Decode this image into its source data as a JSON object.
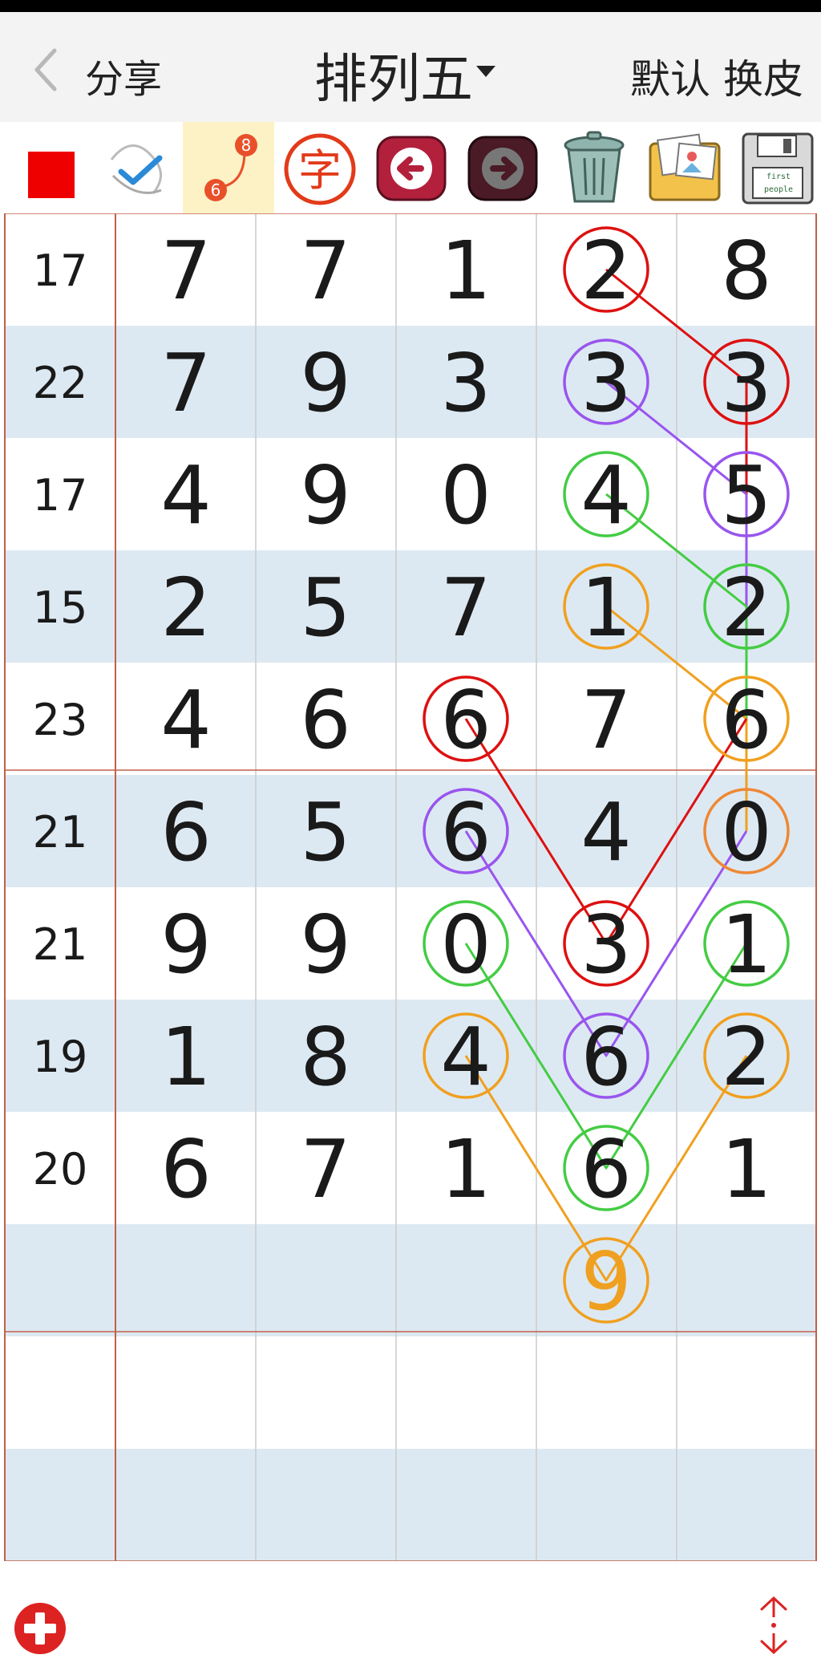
{
  "header": {
    "back_label": "",
    "share_label": "分享",
    "title": "排列五",
    "default_label": "默认",
    "skin_label": "换皮"
  },
  "toolbar": {
    "items": [
      {
        "icon": "red-square-icon",
        "color": "#ee0000"
      },
      {
        "icon": "check-pen-icon"
      },
      {
        "icon": "line-connect-icon",
        "active": true,
        "badge_top": "8",
        "badge_bottom": "6"
      },
      {
        "icon": "char-stamp-icon",
        "text": "字"
      },
      {
        "icon": "undo-arrow-icon"
      },
      {
        "icon": "redo-arrow-icon"
      },
      {
        "icon": "trash-can-icon"
      },
      {
        "icon": "photo-album-icon"
      },
      {
        "icon": "floppy-save-icon",
        "text1": "first",
        "text2": "people"
      }
    ]
  },
  "table": {
    "rows": [
      {
        "sum": "17",
        "digits": [
          "7",
          "7",
          "1",
          "2",
          "8"
        ]
      },
      {
        "sum": "22",
        "digits": [
          "7",
          "9",
          "3",
          "3",
          "3"
        ]
      },
      {
        "sum": "17",
        "digits": [
          "4",
          "9",
          "0",
          "4",
          "5"
        ]
      },
      {
        "sum": "15",
        "digits": [
          "2",
          "5",
          "7",
          "1",
          "2"
        ]
      },
      {
        "sum": "23",
        "digits": [
          "4",
          "6",
          "6",
          "7",
          "6"
        ]
      },
      {
        "sum": "21",
        "digits": [
          "6",
          "5",
          "6",
          "4",
          "0"
        ]
      },
      {
        "sum": "21",
        "digits": [
          "9",
          "9",
          "0",
          "3",
          "1"
        ]
      },
      {
        "sum": "19",
        "digits": [
          "1",
          "8",
          "4",
          "6",
          "2"
        ]
      },
      {
        "sum": "20",
        "digits": [
          "6",
          "7",
          "1",
          "6",
          "1"
        ]
      },
      {
        "sum": "",
        "digits": [
          "",
          "",
          "",
          "",
          ""
        ]
      },
      {
        "sum": "",
        "digits": [
          "",
          "",
          "",
          "",
          ""
        ]
      },
      {
        "sum": "",
        "digits": [
          "",
          "",
          "",
          "",
          ""
        ]
      }
    ],
    "predicted": {
      "row": 9,
      "col": 3,
      "value": "9",
      "color": "#f0a020"
    },
    "circles": [
      {
        "row": 0,
        "col": 3,
        "color": "#dd1111"
      },
      {
        "row": 1,
        "col": 4,
        "color": "#dd1111"
      },
      {
        "row": 1,
        "col": 3,
        "color": "#9955ee"
      },
      {
        "row": 2,
        "col": 4,
        "color": "#9955ee"
      },
      {
        "row": 2,
        "col": 3,
        "color": "#44cc44"
      },
      {
        "row": 3,
        "col": 4,
        "color": "#44cc44"
      },
      {
        "row": 3,
        "col": 3,
        "color": "#f0a020"
      },
      {
        "row": 4,
        "col": 4,
        "color": "#f0a020"
      },
      {
        "row": 4,
        "col": 2,
        "color": "#dd1111"
      },
      {
        "row": 5,
        "col": 4,
        "color": "#ee8833"
      },
      {
        "row": 5,
        "col": 2,
        "color": "#9955ee"
      },
      {
        "row": 6,
        "col": 2,
        "color": "#44cc44"
      },
      {
        "row": 6,
        "col": 3,
        "color": "#dd1111"
      },
      {
        "row": 6,
        "col": 4,
        "color": "#44cc44"
      },
      {
        "row": 7,
        "col": 2,
        "color": "#f0a020"
      },
      {
        "row": 7,
        "col": 3,
        "color": "#9955ee"
      },
      {
        "row": 7,
        "col": 4,
        "color": "#f0a020"
      },
      {
        "row": 8,
        "col": 3,
        "color": "#44cc44"
      },
      {
        "row": 9,
        "col": 3,
        "color": "#f0a020"
      }
    ],
    "lines": [
      {
        "color": "#dd1111",
        "points": [
          [
            0,
            3
          ],
          [
            1,
            4
          ]
        ]
      },
      {
        "color": "#dd1111",
        "points": [
          [
            1,
            4
          ],
          [
            5,
            4
          ]
        ]
      },
      {
        "color": "#9955ee",
        "points": [
          [
            1,
            3
          ],
          [
            2,
            4
          ]
        ]
      },
      {
        "color": "#9955ee",
        "points": [
          [
            2,
            4
          ],
          [
            5,
            4
          ]
        ]
      },
      {
        "color": "#44cc44",
        "points": [
          [
            2,
            3
          ],
          [
            3,
            4
          ]
        ]
      },
      {
        "color": "#44cc44",
        "points": [
          [
            3,
            4
          ],
          [
            5,
            4
          ]
        ]
      },
      {
        "color": "#f0a020",
        "points": [
          [
            3,
            3
          ],
          [
            4,
            4
          ]
        ]
      },
      {
        "color": "#f0a020",
        "points": [
          [
            4,
            4
          ],
          [
            5,
            4
          ]
        ]
      },
      {
        "color": "#dd1111",
        "points": [
          [
            4,
            2
          ],
          [
            6,
            3
          ],
          [
            4,
            4
          ]
        ]
      },
      {
        "color": "#9955ee",
        "points": [
          [
            5,
            2
          ],
          [
            7,
            3
          ],
          [
            5,
            4
          ]
        ]
      },
      {
        "color": "#44cc44",
        "points": [
          [
            6,
            2
          ],
          [
            8,
            3
          ],
          [
            6,
            4
          ]
        ]
      },
      {
        "color": "#f0a020",
        "points": [
          [
            7,
            2
          ],
          [
            9,
            3
          ],
          [
            7,
            4
          ]
        ]
      }
    ],
    "colors": {
      "row_alt": "#dde9f2",
      "row_plain": "#ffffff",
      "red_border": "#c0604a",
      "grid_line": "#cccccc",
      "digit": "#1a1a1a"
    }
  },
  "footer": {
    "add_icon": "plus-circle-icon",
    "scroll_icon": "scroll-updown-icon",
    "accent": "#dd2222"
  }
}
